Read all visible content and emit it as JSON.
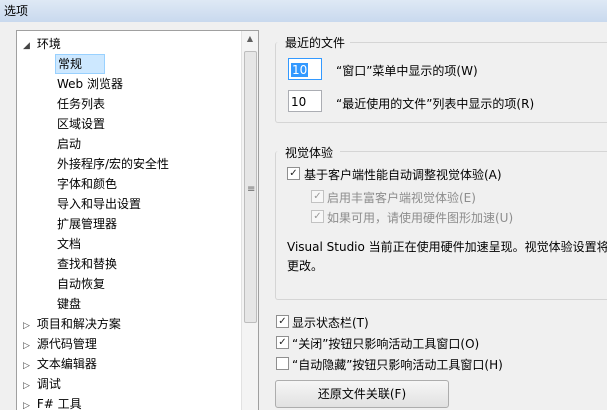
{
  "window": {
    "title": "选项"
  },
  "tree": {
    "items": [
      {
        "label": "环境",
        "level": 0,
        "state": "expanded"
      },
      {
        "label": "常规",
        "level": 1,
        "selected": true
      },
      {
        "label": "Web 浏览器",
        "level": 1
      },
      {
        "label": "任务列表",
        "level": 1
      },
      {
        "label": "区域设置",
        "level": 1
      },
      {
        "label": "启动",
        "level": 1
      },
      {
        "label": "外接程序/宏的安全性",
        "level": 1
      },
      {
        "label": "字体和颜色",
        "level": 1
      },
      {
        "label": "导入和导出设置",
        "level": 1
      },
      {
        "label": "扩展管理器",
        "level": 1
      },
      {
        "label": "文档",
        "level": 1
      },
      {
        "label": "查找和替换",
        "level": 1
      },
      {
        "label": "自动恢复",
        "level": 1
      },
      {
        "label": "键盘",
        "level": 1
      },
      {
        "label": "项目和解决方案",
        "level": 0,
        "state": "collapsed"
      },
      {
        "label": "源代码管理",
        "level": 0,
        "state": "collapsed"
      },
      {
        "label": "文本编辑器",
        "level": 0,
        "state": "collapsed"
      },
      {
        "label": "调试",
        "level": 0,
        "state": "collapsed"
      },
      {
        "label": "F# 工具",
        "level": 0,
        "state": "collapsed"
      }
    ]
  },
  "recent_files": {
    "title": "最近的文件",
    "window_menu_count": "10",
    "window_menu_label": "“窗口”菜单中显示的项(W)",
    "recent_list_count": "10",
    "recent_list_label": "“最近使用的文件”列表中显示的项(R)"
  },
  "visual": {
    "title": "视觉体验",
    "auto_adjust_label": "基于客户端性能自动调整视觉体验(A)",
    "auto_adjust_checked": true,
    "rich_label": "启用丰富客户端视觉体验(E)",
    "rich_checked": true,
    "hw_label": "如果可用，请使用硬件图形加速(U)",
    "hw_checked": true,
    "info_line1": "Visual Studio 当前正在使用硬件加速呈现。视觉体验设置将",
    "info_line2": "更改。"
  },
  "misc": {
    "statusbar_label": "显示状态栏(T)",
    "statusbar_checked": true,
    "close_label": "“关闭”按钮只影响活动工具窗口(O)",
    "close_checked": true,
    "autohide_label": "“自动隐藏”按钮只影响活动工具窗口(H)",
    "autohide_checked": false,
    "restore_button": "还原文件关联(F)"
  },
  "icons": {
    "expanded": "◢",
    "collapsed": "▷",
    "check": "✓",
    "scroll_up": "▲",
    "grip": "≡"
  }
}
